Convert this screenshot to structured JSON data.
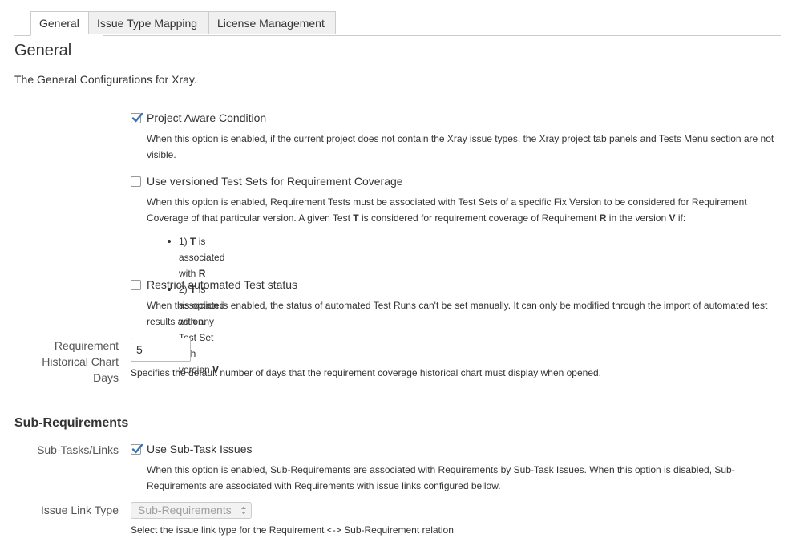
{
  "tabs": [
    {
      "label": "General",
      "active": true
    },
    {
      "label": "Issue Type Mapping",
      "active": false
    },
    {
      "label": "License Management",
      "active": false
    }
  ],
  "page": {
    "title": "General",
    "description": "The General Configurations for Xray."
  },
  "options": {
    "project_aware": {
      "label": "Project Aware Condition",
      "checked": true,
      "description": "When this option is enabled, if the current project does not contain the Xray issue types, the Xray project tab panels and Tests Menu section are not visible."
    },
    "versioned_test_sets": {
      "label": "Use versioned Test Sets for Requirement Coverage",
      "checked": false,
      "desc_line1": "When this option is enabled, Requirement Tests must be associated with Test Sets of a specific Fix Version to be considered for Requirement",
      "desc_line2_a": "Coverage of that particular version. A given Test ",
      "desc_t": "T",
      "desc_line2_b": " is considered for requirement coverage of Requirement ",
      "desc_r": "R",
      "desc_line2_c": " in the version ",
      "desc_v": "V",
      "desc_line2_d": " if:",
      "bullets": [
        {
          "prefix": "1) ",
          "t": "T",
          "mid": " is associated with ",
          "end": "R"
        },
        {
          "prefix": "2) ",
          "t": "T",
          "mid": " is associated with any Test Set with version ",
          "end": "V"
        }
      ]
    },
    "restrict_automated": {
      "label": "Restrict automated Test status",
      "checked": false,
      "description": "When this option is enabled, the status of automated Test Runs can't be set manually. It can only be modified through the import of automated test results action."
    }
  },
  "historical_chart": {
    "label_line1": "Requirement",
    "label_line2": "Historical Chart",
    "label_line3": "Days",
    "value": "5",
    "help": "Specifies the default number of days that the requirement coverage historical chart must display when opened."
  },
  "sub_requirements": {
    "title": "Sub-Requirements",
    "subtasks_label": "Sub-Tasks/Links",
    "use_subtask": {
      "label": "Use Sub-Task Issues",
      "checked": true,
      "description": "When this option is enabled, Sub-Requirements are associated with Requirements by Sub-Task Issues. When this option is disabled, Sub-Requirements are associated with Requirements with issue links configured bellow."
    },
    "link_type_label": "Issue Link Type",
    "link_type_value": "Sub-Requirements",
    "link_type_help": "Select the issue link type for the Requirement <-> Sub-Requirement relation"
  },
  "colors": {
    "check_blue": "#3b73af",
    "tab_border": "#cccccc"
  }
}
